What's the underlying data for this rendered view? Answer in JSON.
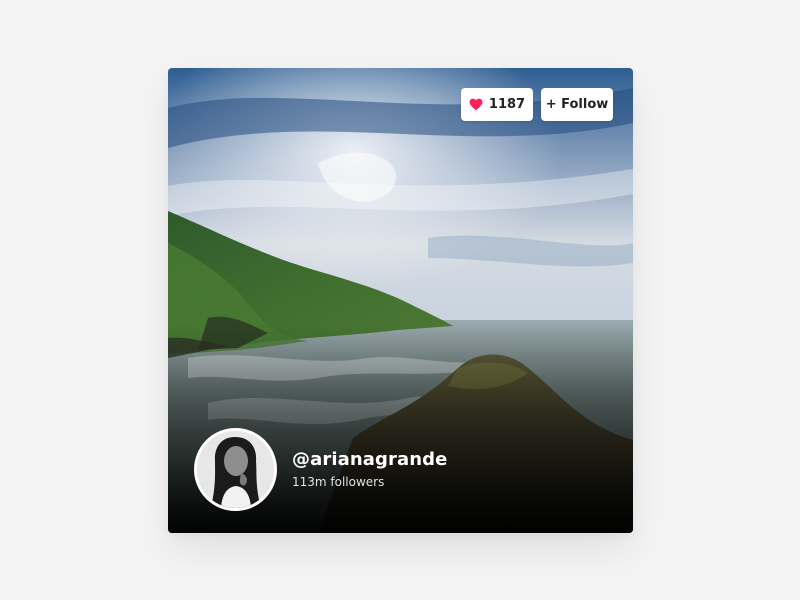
{
  "card": {
    "likes": "1187",
    "follow_label": "+ Follow",
    "username": "@arianagrande",
    "followers": "113m followers"
  },
  "icons": {
    "like": "heart-icon"
  },
  "colors": {
    "background": "#f4f4f4",
    "heart": "#ff1f5a",
    "button_bg": "#ffffff",
    "text_light": "#ffffff"
  }
}
